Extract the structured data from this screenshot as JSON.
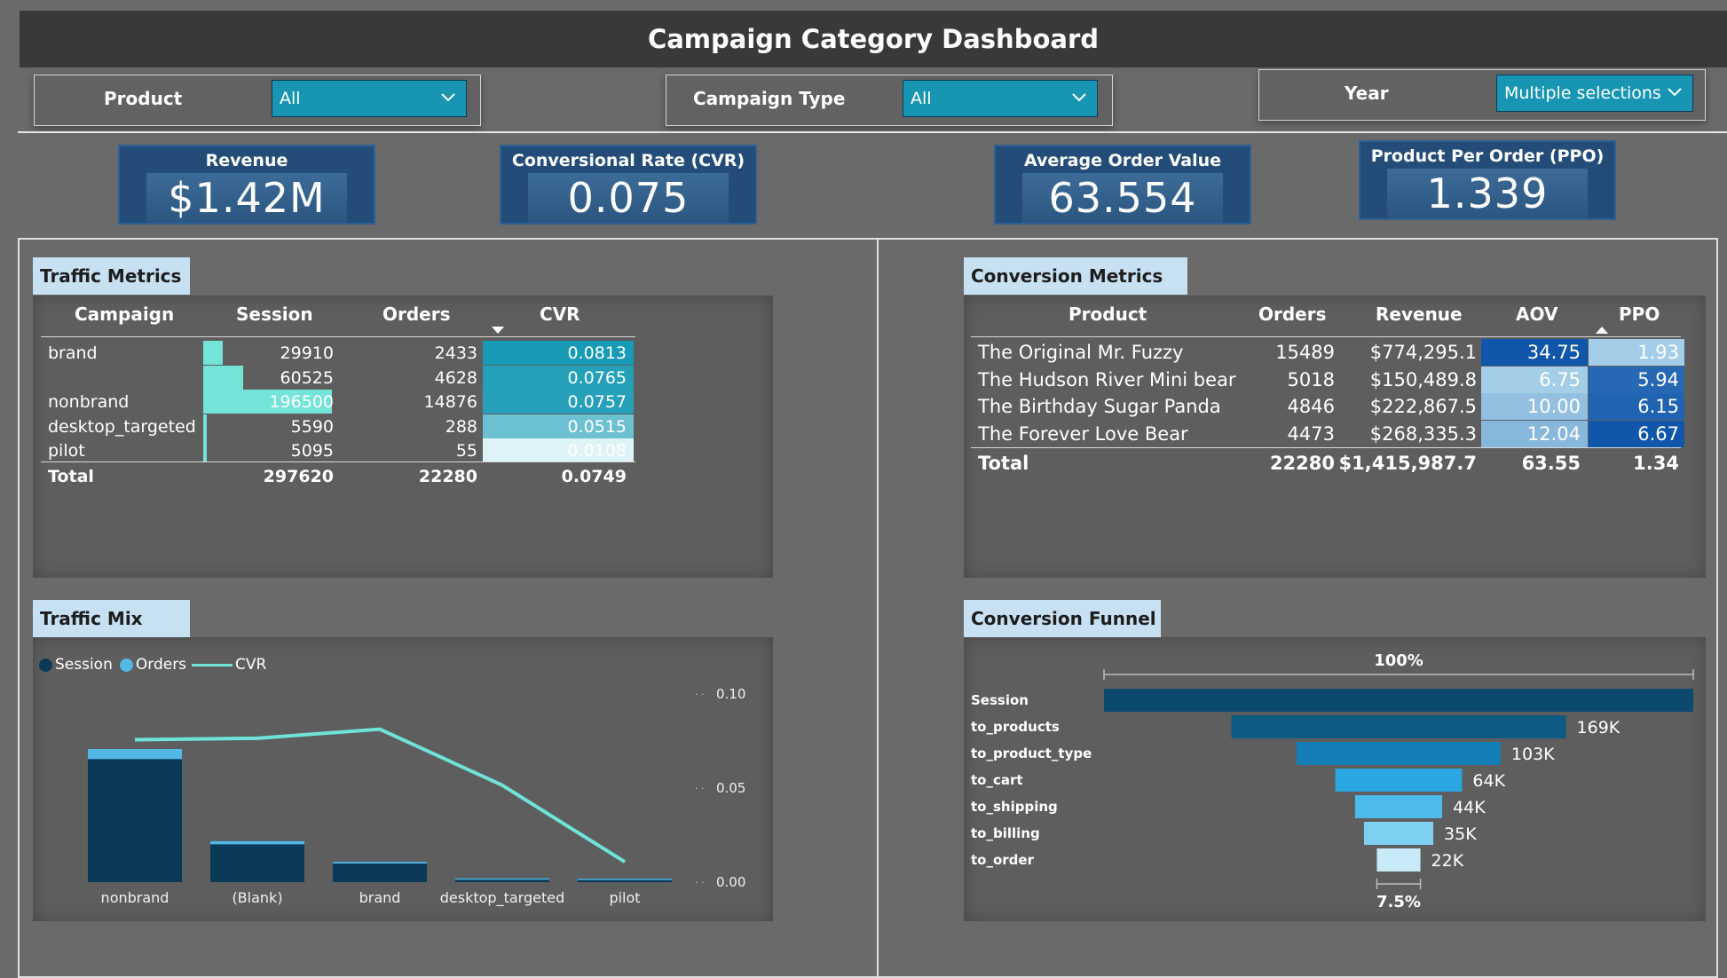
{
  "title": "Campaign Category Dashboard",
  "slicers": {
    "product": {
      "label": "Product",
      "value": "All"
    },
    "campaign_type": {
      "label": "Campaign Type",
      "value": "All"
    },
    "year": {
      "label": "Year",
      "value": "Multiple selections"
    }
  },
  "kpis": [
    {
      "title": "Revenue",
      "value": "$1.42M"
    },
    {
      "title": "Conversional Rate (CVR)",
      "value": "0.075"
    },
    {
      "title": "Average Order Value (AOV)",
      "value": "63.554"
    },
    {
      "title": "Product Per Order (PPO)",
      "value": "1.339"
    }
  ],
  "traffic_metrics": {
    "title": "Traffic Metrics",
    "columns": [
      "Campaign",
      "Session",
      "Orders",
      "CVR"
    ],
    "rows": [
      {
        "campaign": "brand",
        "session": "29910",
        "orders": "2433",
        "cvr": "0.0813",
        "session_num": 29910,
        "cvr_num": 0.0813
      },
      {
        "campaign": "",
        "session": "60525",
        "orders": "4628",
        "cvr": "0.0765",
        "session_num": 60525,
        "cvr_num": 0.0765
      },
      {
        "campaign": "nonbrand",
        "session": "196500",
        "orders": "14876",
        "cvr": "0.0757",
        "session_num": 196500,
        "cvr_num": 0.0757
      },
      {
        "campaign": "desktop_targeted",
        "session": "5590",
        "orders": "288",
        "cvr": "0.0515",
        "session_num": 5590,
        "cvr_num": 0.0515
      },
      {
        "campaign": "pilot",
        "session": "5095",
        "orders": "55",
        "cvr": "0.0108",
        "session_num": 5095,
        "cvr_num": 0.0108
      }
    ],
    "total": {
      "label": "Total",
      "session": "297620",
      "orders": "22280",
      "cvr": "0.0749"
    }
  },
  "conversion_metrics": {
    "title": "Conversion Metrics",
    "columns": [
      "Product",
      "Orders",
      "Revenue",
      "AOV",
      "PPO"
    ],
    "rows": [
      {
        "product": "The Original Mr. Fuzzy",
        "orders": "15489",
        "revenue": "$774,295.1",
        "aov": "34.75",
        "ppo": "1.93",
        "aov_num": 34.75,
        "ppo_num": 1.93
      },
      {
        "product": "The Hudson River Mini bear",
        "orders": "5018",
        "revenue": "$150,489.8",
        "aov": "6.75",
        "ppo": "5.94",
        "aov_num": 6.75,
        "ppo_num": 5.94
      },
      {
        "product": "The Birthday Sugar Panda",
        "orders": "4846",
        "revenue": "$222,867.5",
        "aov": "10.00",
        "ppo": "6.15",
        "aov_num": 10.0,
        "ppo_num": 6.15
      },
      {
        "product": "The Forever Love Bear",
        "orders": "4473",
        "revenue": "$268,335.3",
        "aov": "12.04",
        "ppo": "6.67",
        "aov_num": 12.04,
        "ppo_num": 6.67
      }
    ],
    "total": {
      "label": "Total",
      "orders": "22280",
      "revenue": "$1,415,987.7",
      "aov": "63.55",
      "ppo": "1.34"
    }
  },
  "traffic_mix": {
    "title": "Traffic Mix",
    "legend": [
      {
        "name": "Session",
        "color": "#0b3a58"
      },
      {
        "name": "Orders",
        "color": "#53b8e6"
      },
      {
        "name": "CVR",
        "color": "#6fe3d8"
      }
    ],
    "y2_ticks": [
      "0.10",
      "0.05",
      "0.00"
    ]
  },
  "conversion_funnel": {
    "title": "Conversion Funnel",
    "top_label": "100%",
    "bottom_label": "7.5%",
    "colors": [
      "#0b4a6c",
      "#0d5a82",
      "#137fb6",
      "#2aa6e0",
      "#4bbbe9",
      "#7dd0f0",
      "#c8e9f8"
    ]
  },
  "chart_data": [
    {
      "type": "bar",
      "title": "Traffic Mix",
      "categories": [
        "nonbrand",
        "(Blank)",
        "brand",
        "desktop_targeted",
        "pilot"
      ],
      "series": [
        {
          "name": "Session",
          "values": [
            196500,
            60525,
            29910,
            5590,
            5095
          ]
        },
        {
          "name": "Orders",
          "values": [
            14876,
            4628,
            2433,
            288,
            55
          ]
        },
        {
          "name": "CVR",
          "values": [
            0.0757,
            0.0765,
            0.0813,
            0.0515,
            0.0108
          ]
        }
      ],
      "y2lim": [
        0,
        0.1
      ],
      "legend": "top-left"
    },
    {
      "type": "bar",
      "title": "Conversion Funnel",
      "categories": [
        "Session",
        "to_products",
        "to_product_type",
        "to_cart",
        "to_shipping",
        "to_billing",
        "to_order"
      ],
      "values": [
        297620,
        169000,
        103000,
        64000,
        44000,
        35000,
        22000
      ],
      "value_labels": [
        "",
        "169K",
        "103K",
        "64K",
        "44K",
        "35K",
        "22K"
      ]
    }
  ]
}
